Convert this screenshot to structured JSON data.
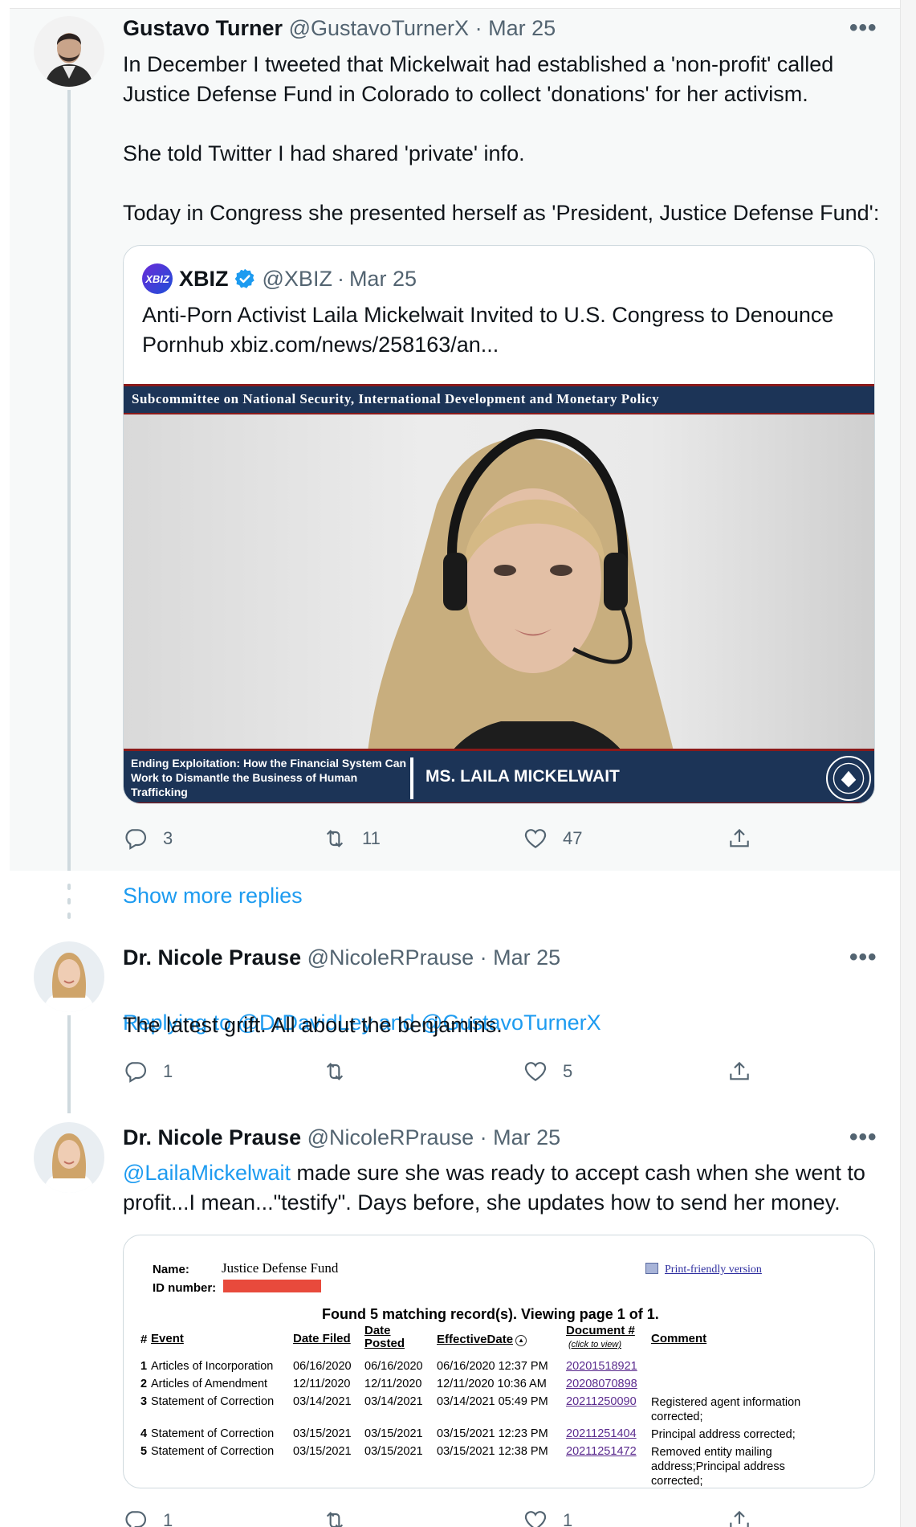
{
  "tweet1": {
    "name": "Gustavo Turner",
    "handle": "@GustavoTurnerX",
    "sep": "·",
    "date": "Mar 25",
    "more": "•••",
    "text": "In December I tweeted that Mickelwait had established a 'non-profit' called Justice Defense Fund in Colorado to collect 'donations' for her activism.\n\nShe told Twitter I had shared 'private' info.\n\nToday in Congress she presented herself as 'President, Justice Defense Fund':",
    "quote": {
      "logo": "XBIZ",
      "name": "XBIZ",
      "handle": "@XBIZ",
      "sep": "·",
      "date": "Mar 25",
      "text_main": "Anti-Porn Activist Laila Mickelwait Invited to U.S. Congress to Denounce Pornhub ",
      "text_link": "xbiz.com/news/258163/an...",
      "video": {
        "banner_top": "Subcommittee on National Security, International Development and Monetary Policy",
        "caption_left": "Ending Exploitation: How the Financial System Can Work to Dismantle the Business of Human Trafficking",
        "caption_name": "MS. LAILA MICKELWAIT"
      }
    },
    "actions": {
      "reply": "3",
      "retweet": "11",
      "like": "47"
    }
  },
  "show_more": "Show more replies",
  "tweet2": {
    "name": "Dr. Nicole Prause",
    "handle": "@NicoleRPrause",
    "sep": "·",
    "date": "Mar 25",
    "more": "•••",
    "replying_prefix": "Replying to ",
    "replying_to": "@DrDavidLey and @GustavoTurnerX",
    "text": "The latest grift. All about the benjamins.",
    "actions": {
      "reply": "1",
      "retweet": "",
      "like": "5"
    }
  },
  "tweet3": {
    "name": "Dr. Nicole Prause",
    "handle": "@NicoleRPrause",
    "sep": "·",
    "date": "Mar 25",
    "more": "•••",
    "mention": "@LailaMickelwait",
    "text": " made sure she was ready to accept cash when she went to profit...I mean...\"testify\". Days before, she updates how to send her money.",
    "doc": {
      "name_label": "Name:",
      "name_value": "Justice Defense Fund",
      "id_label": "ID number:",
      "print_link": "Print-friendly version",
      "found": "Found 5 matching record(s).  Viewing page 1 of 1.",
      "headers": {
        "num": "#",
        "event": "Event",
        "date_filed": "Date Filed",
        "date_posted": "Date Posted",
        "effective": "EffectiveDate",
        "document": "Document #",
        "document_sub": "(click to view)",
        "comment": "Comment"
      },
      "rows": [
        {
          "num": "1",
          "event": "Articles of Incorporation",
          "filed": "06/16/2020",
          "posted": "06/16/2020",
          "effective": "06/16/2020 12:37 PM",
          "doc": "20201518921",
          "comment": ""
        },
        {
          "num": "2",
          "event": "Articles of Amendment",
          "filed": "12/11/2020",
          "posted": "12/11/2020",
          "effective": "12/11/2020 10:36 AM",
          "doc": "20208070898",
          "comment": ""
        },
        {
          "num": "3",
          "event": "Statement of Correction",
          "filed": "03/14/2021",
          "posted": "03/14/2021",
          "effective": "03/14/2021 05:49 PM",
          "doc": "20211250090",
          "comment": "Registered agent information corrected;"
        },
        {
          "num": "4",
          "event": "Statement of Correction",
          "filed": "03/15/2021",
          "posted": "03/15/2021",
          "effective": "03/15/2021 12:23 PM",
          "doc": "20211251404",
          "comment": "Principal address corrected;"
        },
        {
          "num": "5",
          "event": "Statement of Correction",
          "filed": "03/15/2021",
          "posted": "03/15/2021",
          "effective": "03/15/2021 12:38 PM",
          "doc": "20211251472",
          "comment": "Removed entity mailing address;Principal address corrected;"
        }
      ]
    },
    "actions": {
      "reply": "1",
      "retweet": "",
      "like": "1"
    }
  }
}
